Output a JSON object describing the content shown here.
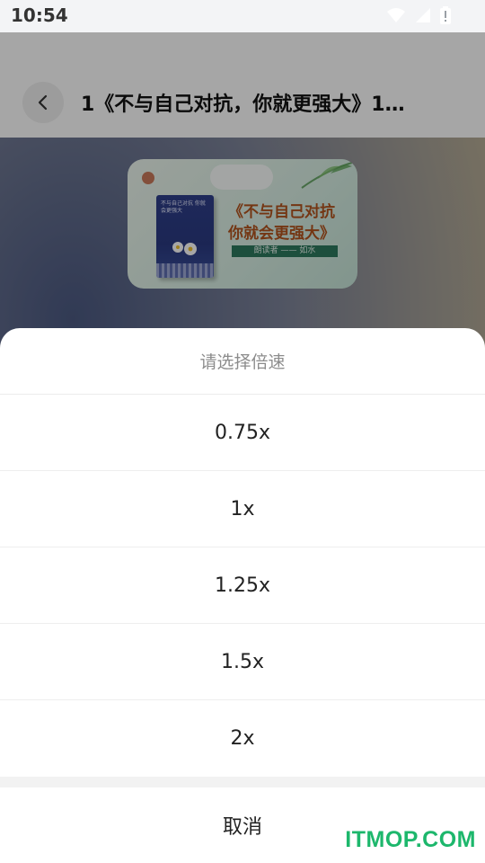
{
  "status_bar": {
    "time": "10:54",
    "icons": [
      "wifi-icon",
      "signal-icon",
      "battery-icon"
    ]
  },
  "header": {
    "back_icon": "chevron-left-icon",
    "title": "1《不与自己对抗，你就更强大》1…"
  },
  "cover": {
    "brand_icon": "logo-icon",
    "book_title": "不与自己对抗 你就会更强大",
    "line1": "《不与自己对抗",
    "line2": "你就会更强大》",
    "reader": "朗读者 —— 如水"
  },
  "speed_sheet": {
    "title": "请选择倍速",
    "options": [
      "0.75x",
      "1x",
      "1.25x",
      "1.5x",
      "2x"
    ],
    "cancel_label": "取消"
  },
  "watermark": "ITMOP.COM",
  "colors": {
    "watermark_green": "#1db76c",
    "cover_title_orange": "#b3541e",
    "reader_badge_green": "#2d7a5f",
    "sheet_title_gray": "#8c8c8c"
  }
}
